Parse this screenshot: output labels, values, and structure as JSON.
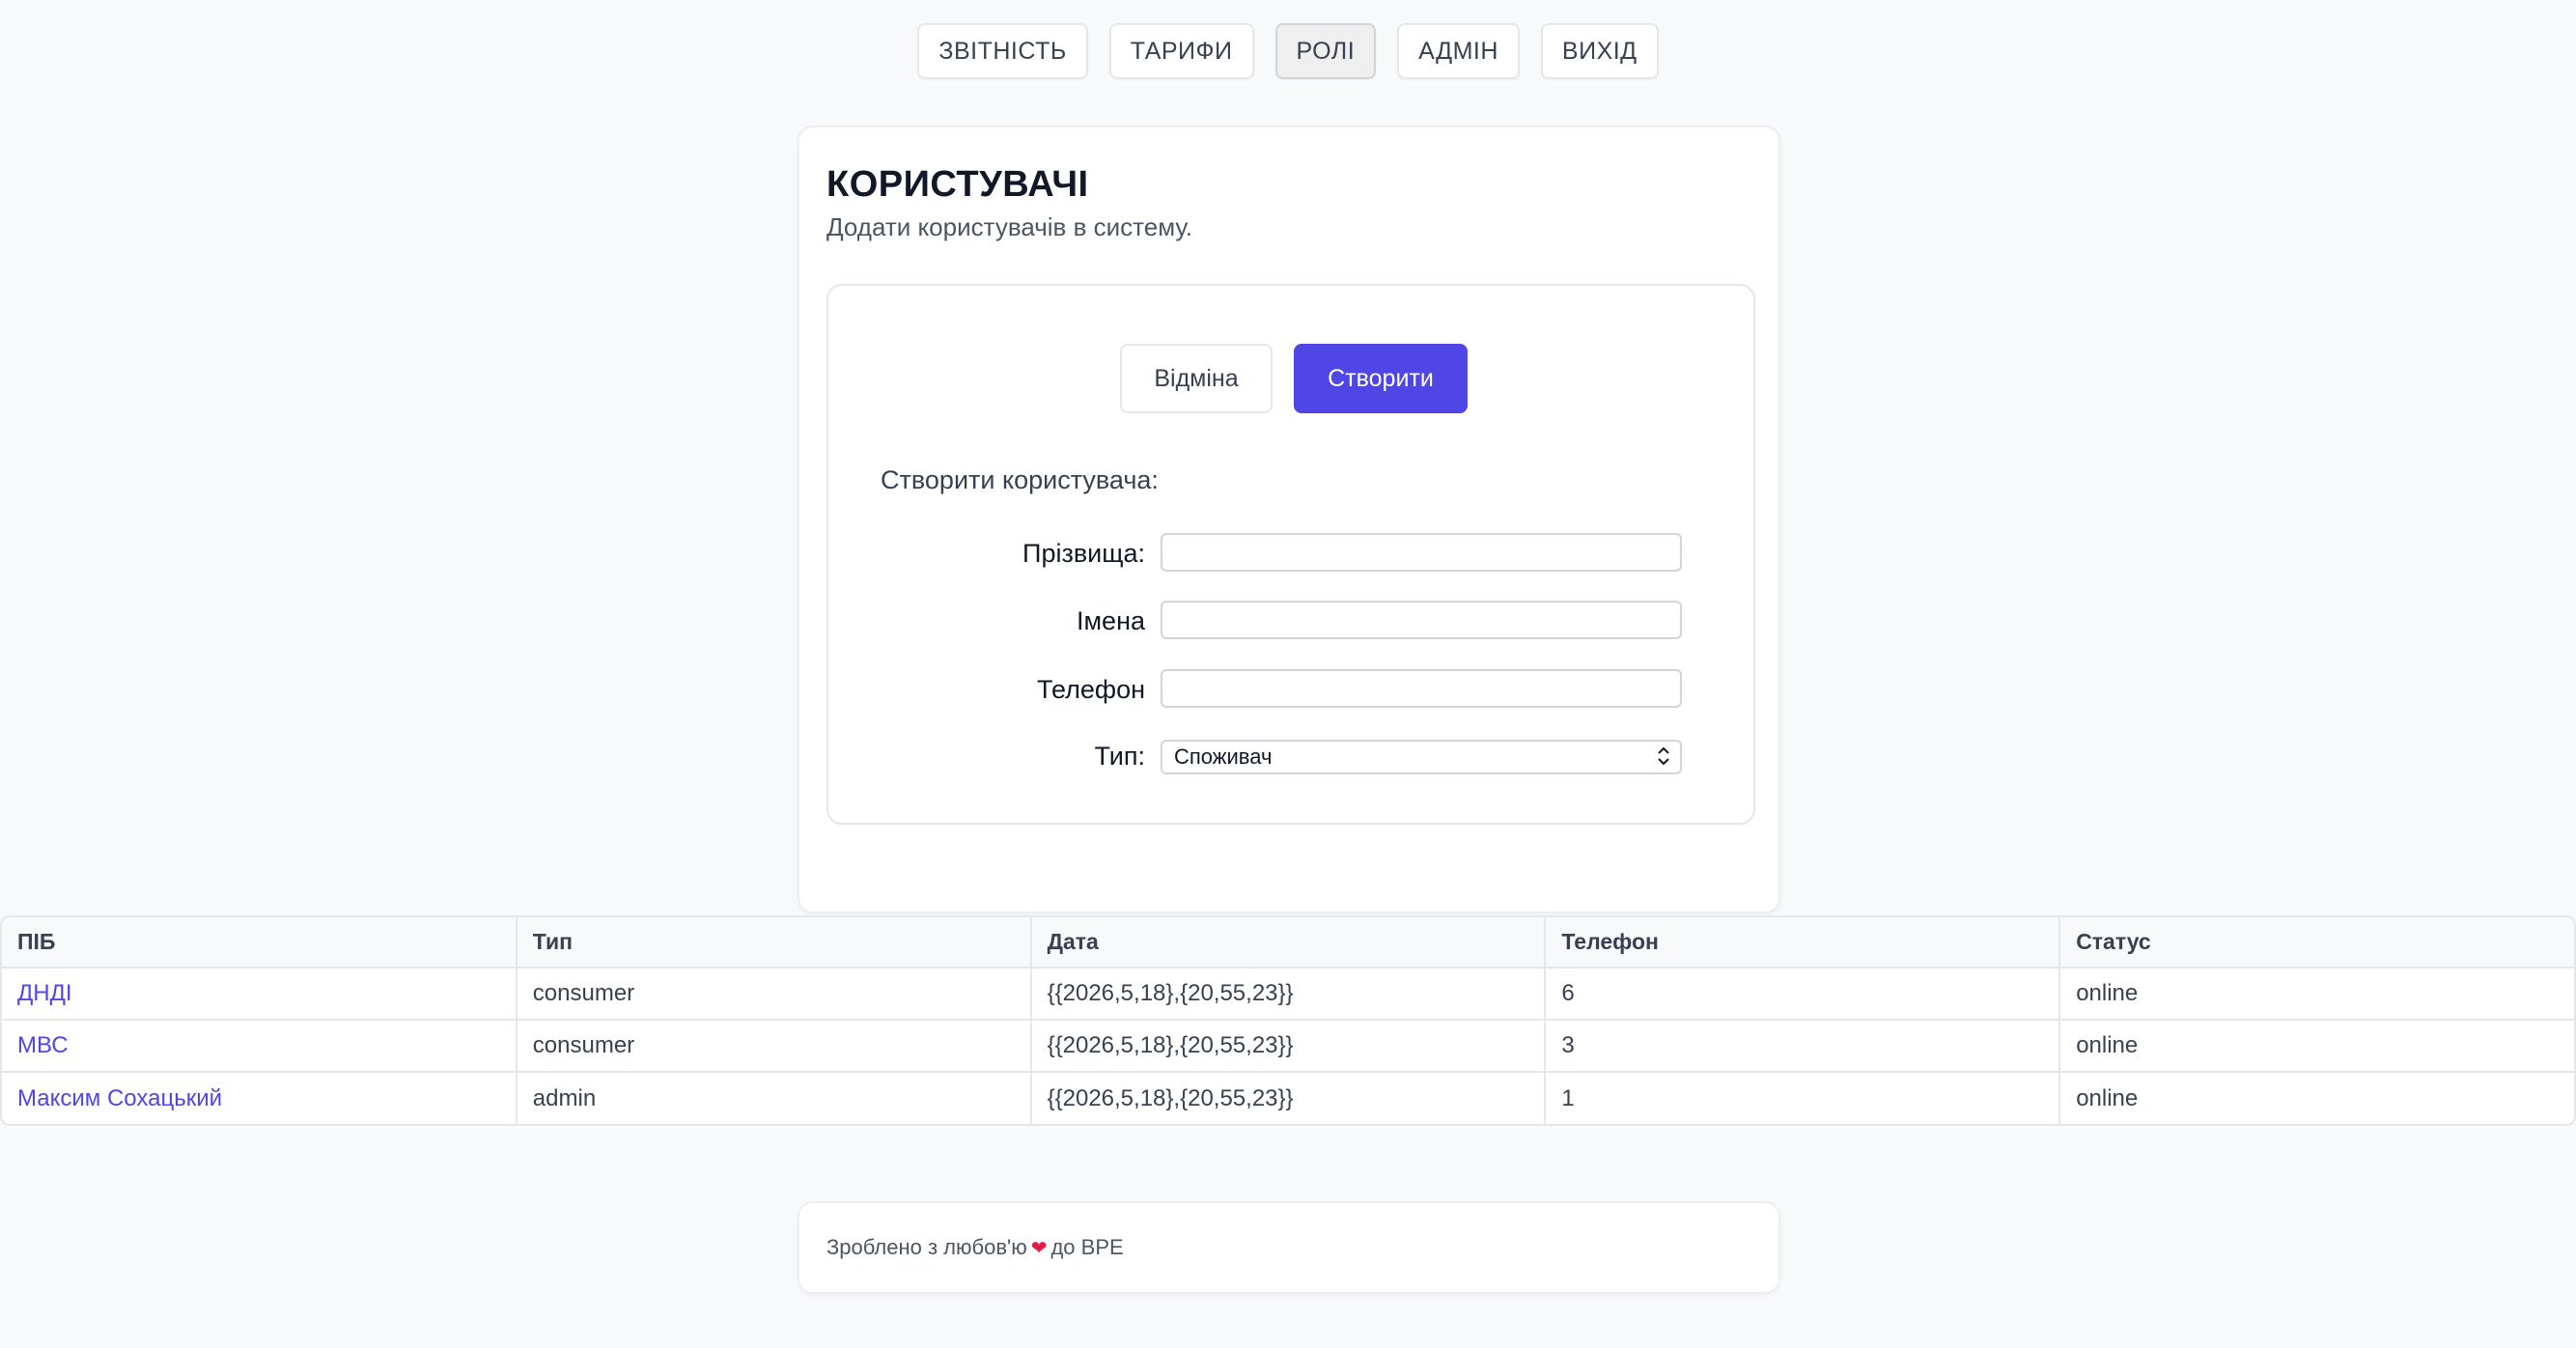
{
  "nav": {
    "items": [
      {
        "label": "ЗВІТНІСТЬ",
        "active": false
      },
      {
        "label": "ТАРИФИ",
        "active": false
      },
      {
        "label": "РОЛІ",
        "active": true
      },
      {
        "label": "АДМІН",
        "active": false
      },
      {
        "label": "ВИХІД",
        "active": false
      }
    ]
  },
  "card": {
    "title": "КОРИСТУВАЧІ",
    "subtitle": "Додати користувачів в систему."
  },
  "form": {
    "cancel_label": "Відміна",
    "create_label": "Створити",
    "heading": "Створити користувача:",
    "fields": {
      "surname_label": "Прізвища:",
      "surname_value": "",
      "names_label": "Імена",
      "names_value": "",
      "phone_label": "Телефон",
      "phone_value": "",
      "type_label": "Тип:",
      "type_value": "Споживач"
    }
  },
  "table": {
    "headers": [
      "ПІБ",
      "Тип",
      "Дата",
      "Телефон",
      "Статус"
    ],
    "rows": [
      [
        "ДНДІ",
        "consumer",
        "{{2026,5,18},{20,55,23}}",
        "6",
        "online"
      ],
      [
        "МВС",
        "consumer",
        "{{2026,5,18},{20,55,23}}",
        "3",
        "online"
      ],
      [
        "Максим Сохацький",
        "admin",
        "{{2026,5,18},{20,55,23}}",
        "1",
        "online"
      ]
    ]
  },
  "footer": {
    "text_before": "Зроблено з любов'ю",
    "heart_icon": "heart-icon",
    "text_after": "до ВРЕ"
  },
  "colors": {
    "accent": "#4f46e5",
    "background": "#f8f9fb",
    "heart": "#e11d48"
  }
}
